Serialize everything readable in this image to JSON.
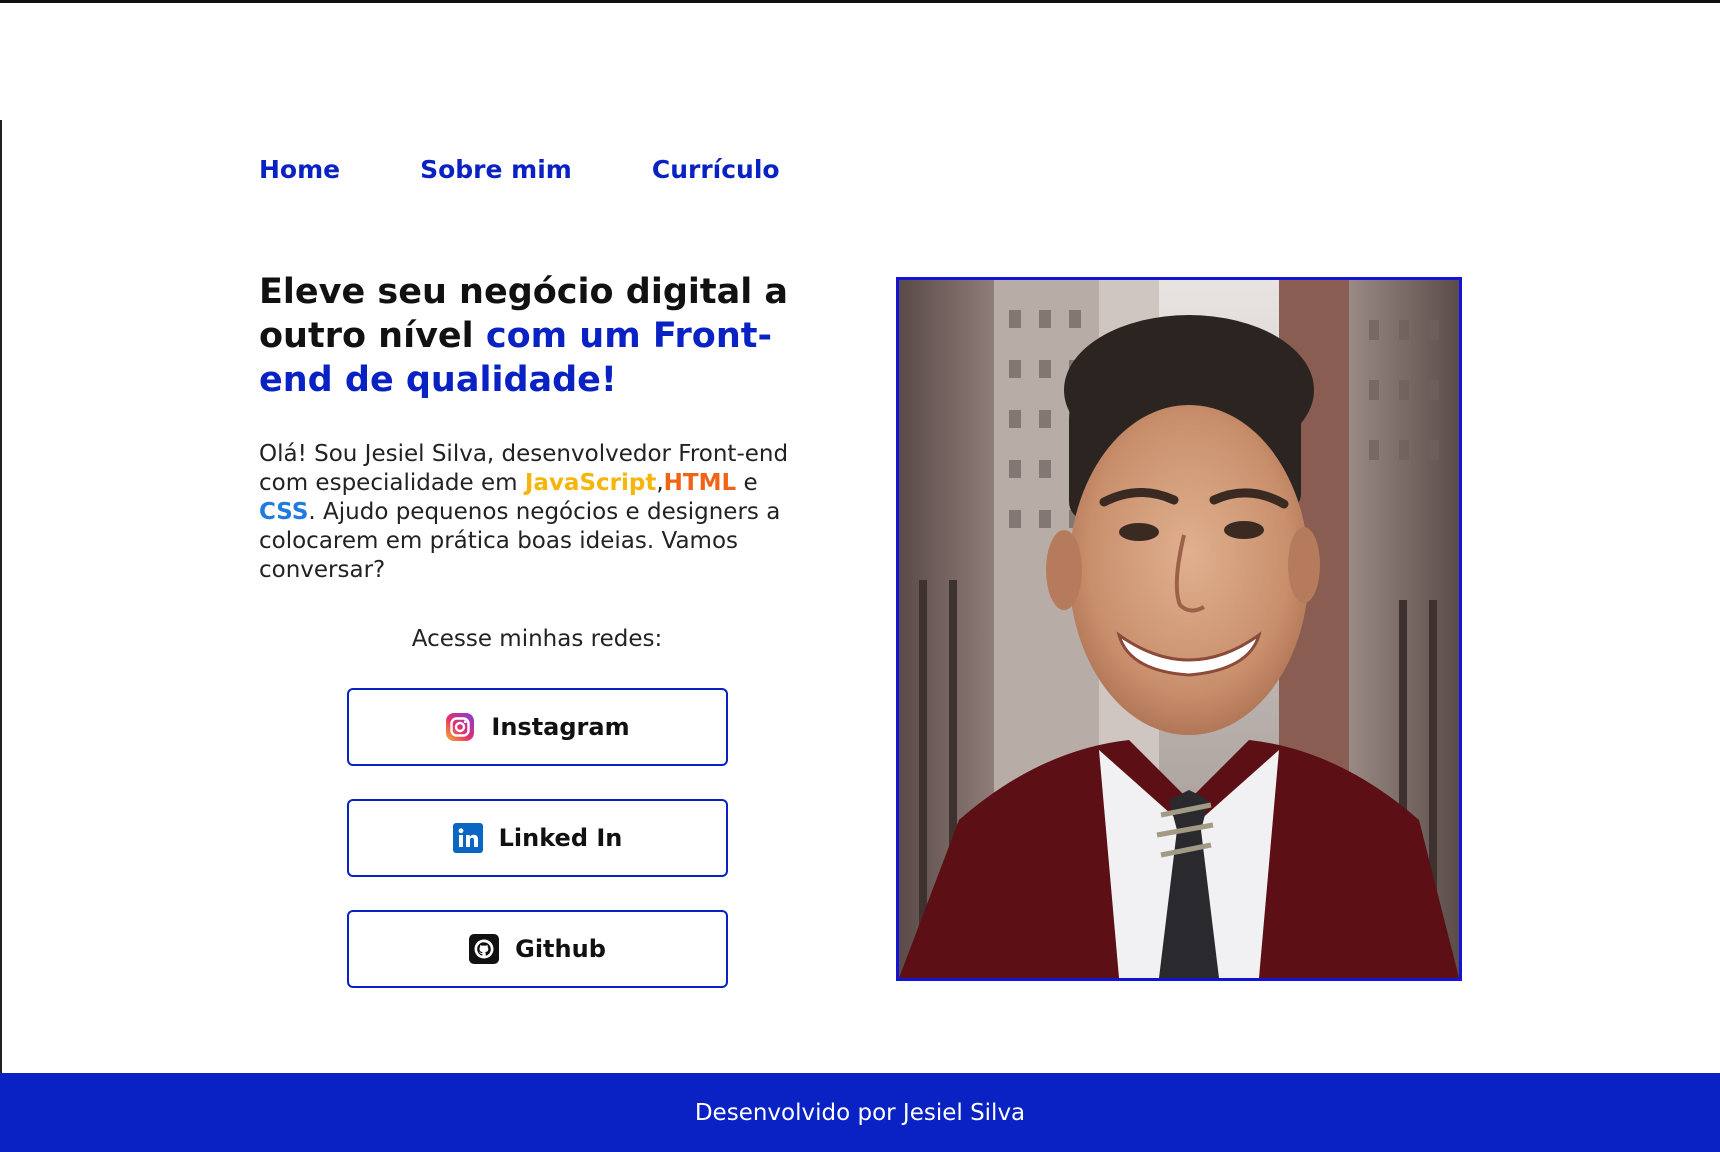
{
  "nav": {
    "items": [
      {
        "label": "Home"
      },
      {
        "label": "Sobre mim"
      },
      {
        "label": "Currículo"
      }
    ]
  },
  "hero": {
    "headline_plain": "Eleve seu negócio digital a outro nível ",
    "headline_accent": "com um Front-end de qualidade!",
    "intro_prefix": "Olá! Sou Jesiel Silva, desenvolvedor Front-end com especialidade em ",
    "kw_js": "JavaScript",
    "sep": ",",
    "kw_html": "HTML",
    "conj": " e ",
    "kw_css": "CSS",
    "intro_suffix": ". Ajudo pequenos negócios e designers a colocarem em prática boas ideias. Vamos conversar?"
  },
  "social": {
    "heading": "Acesse minhas redes:",
    "instagram": {
      "label": "Instagram",
      "icon": "instagram-icon"
    },
    "linkedin": {
      "label": "Linked In",
      "icon": "linkedin-icon"
    },
    "github": {
      "label": "Github",
      "icon": "github-icon"
    }
  },
  "colors": {
    "accent": "#0a22c4",
    "javascript": "#f5b50a",
    "html": "#f06418",
    "css": "#1f7be0",
    "photo_border": "#1414d6"
  },
  "footer": {
    "text": "Desenvolvido por Jesiel Silva"
  }
}
